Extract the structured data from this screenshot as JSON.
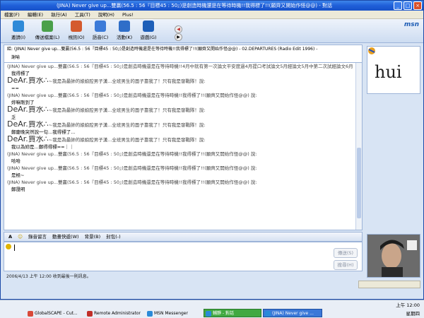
{
  "window": {
    "title": "(JINA) Never give up...雙贏(56.5 : 56『目標45 : 50』)是創造時機還是在等待時機!!我得標了!!(願齊又開始作怪@@) - 對話",
    "controls": [
      "_",
      "□",
      "×"
    ]
  },
  "menu": [
    "檔案(F)",
    "編輯(E)",
    "執行(A)",
    "工具(T)",
    "說明(H)",
    "Plus!"
  ],
  "toolbar": {
    "buttons": [
      {
        "label": "邀請(I)",
        "icon": "invite-icon",
        "color": "#2f8ad8"
      },
      {
        "label": "傳送檔案(L)",
        "icon": "send-file-icon",
        "color": "#4aa04a"
      },
      {
        "label": "視訊(O)",
        "icon": "webcam-icon",
        "color": "#d45a2e"
      },
      {
        "label": "語音(C)",
        "icon": "voice-icon",
        "color": "#3b7ad8"
      },
      {
        "label": "活動(K)",
        "icon": "activities-icon",
        "color": "#2f6ec8"
      },
      {
        "label": "遊戲(G)",
        "icon": "games-icon",
        "color": "#1e5fb8"
      }
    ],
    "logo": "msn"
  },
  "to_field": {
    "line1": "給: (JINA) Never give up...雙贏(56.5 : 56『目標45 : 50』)是創造時機還是在等待時機!!我得標了!!(願齊又開始作怪@@) - 02.DEPARTURES (Radio Edit 1996) -",
    "line2": "謝喻"
  },
  "messages": [
    {
      "header": "(JINA) Never give up...雙贏(56.5 : 56『目標45 : 50』)是創造時機還是在等待時機!!4月中就有第一次論文平安度過4月提口考試論文5月經論文5月中第二次試經論文6月畢業 說:",
      "body": "我得標了",
      "nick_big": false
    },
    {
      "nick": "DeAr.賈水∴",
      "header": "~我是為最帥的娘娘腔男子漢...全班男生的面子靠我了！只有我是發戰隊！說:",
      "body": "==",
      "nick_big": true
    },
    {
      "header": "(JINA) Never give up...雙贏(56.5 : 56『目標45 : 50』)是創造時機還是在等待時機!!我得標了!!(願齊又開始作怪@@) 說:",
      "body": "妳嘛剛到了",
      "nick_big": false
    },
    {
      "nick": "DeAr.賈水∴",
      "header": "~我是為最帥的娘娘腔男子漢...全班男生的面子靠我了！只有我是發戰隊！說:",
      "body": "乏",
      "nick_big": true
    },
    {
      "nick": "DeAr.賈水∴",
      "header": "~我是為最帥的娘娘腔男子漢...全班男生的面子靠我了！只有我是發戰隊！說:",
      "body": "鄭慶晚突然說一句...我得標了...",
      "nick_big": true
    },
    {
      "nick": "DeAr.賈水∴",
      "header": "~我是為最帥的娘娘腔男子漢...全班男生的面子靠我了！只有我是發戰隊！說:",
      "body": "我以為妳是...鄭得得標==｜｜",
      "nick_big": true
    },
    {
      "header": "(JINA) Never give up...雙贏(56.5 : 56『目標45 : 50』)是創造時機還是在等待時機!!我得標了!!(願齊又開始作怪@@) 說:",
      "body": "哈哈",
      "nick_big": false
    },
    {
      "header": "(JINA) Never give up...雙贏(56.5 : 56『目標45 : 50』)是創造時機還是在等待時機!!我得標了!!(願齊又開始作怪@@) 說:",
      "body": "是極~",
      "nick_big": false
    },
    {
      "header": "(JINA) Never give up...雙贏(56.5 : 56『目標45 : 50』)是創造時機還是在等待時機!!我得標了!!(願齊又開始作怪@@) 說:",
      "body": "鄭晟明",
      "nick_big": false
    }
  ],
  "format_bar": [
    "A",
    "☺",
    "錄音留言",
    "動畫快遞(W)",
    "背景(B)",
    "封包(-)"
  ],
  "input": {
    "value": "",
    "send_label": "傳送(S)",
    "search_label": "搜尋(H)"
  },
  "status": "2006/4/13 上午 12:00 收到最後一則訊息。",
  "avatar1": {
    "text": "hui"
  },
  "taskbar": {
    "tasks": [
      {
        "label": "GlobalSCAPE - Cut...",
        "state": "normal"
      },
      {
        "label": "Remote Administrator",
        "state": "normal"
      },
      {
        "label": "MSN Messenger",
        "state": "normal"
      },
      {
        "label": "輔靜 - 對話",
        "state": "active"
      },
      {
        "label": "(JINA) Never give ...",
        "state": "focus"
      }
    ],
    "time": "上午 12:00",
    "day": "星期四"
  }
}
